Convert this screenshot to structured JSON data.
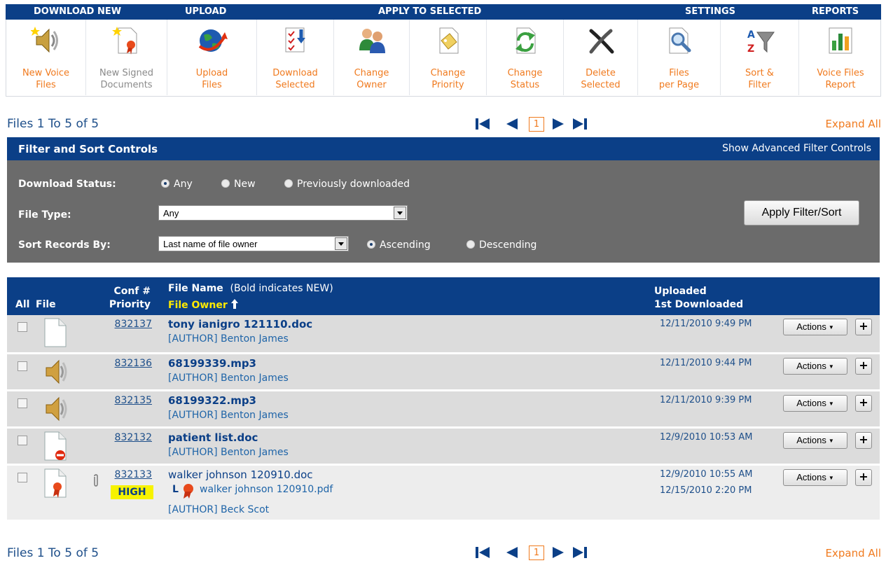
{
  "toolbar": {
    "groups": {
      "download_new": "DOWNLOAD NEW",
      "upload": "UPLOAD",
      "apply_to_selected": "APPLY TO SELECTED",
      "settings": "SETTINGS",
      "reports": "REPORTS"
    },
    "items": [
      {
        "label": "New Voice\nFiles",
        "icon": "speaker-new-icon"
      },
      {
        "label": "New Signed\nDocuments",
        "icon": "signed-document-new-icon"
      },
      {
        "label": "Upload\nFiles",
        "icon": "globe-upload-icon"
      },
      {
        "label": "Download\nSelected",
        "icon": "download-checklist-icon"
      },
      {
        "label": "Change\nOwner",
        "icon": "people-icon"
      },
      {
        "label": "Change\nPriority",
        "icon": "priority-tag-icon"
      },
      {
        "label": "Change\nStatus",
        "icon": "refresh-arrows-icon"
      },
      {
        "label": "Delete\nSelected",
        "icon": "delete-x-icon"
      },
      {
        "label": "Files\nper Page",
        "icon": "magnifier-page-icon"
      },
      {
        "label": "Sort &\nFilter",
        "icon": "sort-filter-icon"
      },
      {
        "label": "Voice Files\nReport",
        "icon": "bar-chart-report-icon"
      }
    ]
  },
  "pager": {
    "files_count": "Files 1 To 5 of 5",
    "page": "1",
    "expand_all": "Expand All"
  },
  "filter": {
    "title": "Filter and Sort Controls",
    "advanced_link": "Show Advanced Filter Controls",
    "download_status_label": "Download Status:",
    "download_status_options": [
      "Any",
      "New",
      "Previously downloaded"
    ],
    "download_status_selected": "Any",
    "file_type_label": "File Type:",
    "file_type_value": "Any",
    "sort_label": "Sort Records By:",
    "sort_value": "Last name of file owner",
    "sort_order_options": [
      "Ascending",
      "Descending"
    ],
    "sort_order_selected": "Ascending",
    "apply_button": "Apply Filter/Sort"
  },
  "table": {
    "col_all": "All",
    "col_file": "File",
    "col_conf": "Conf #",
    "col_priority": "Priority",
    "col_file_name": "File Name",
    "col_file_name_note": "(Bold indicates NEW)",
    "col_file_owner": "File Owner",
    "col_uploaded": "Uploaded",
    "col_first_downloaded": "1st Downloaded",
    "actions_label": "Actions",
    "plus_label": "+",
    "rows": [
      {
        "conf": "832137",
        "file_name": "tony ianigro 121110.doc",
        "owner": "[AUTHOR] Benton James",
        "uploaded": "12/11/2010 9:49 PM",
        "icon": "document-icon"
      },
      {
        "conf": "832136",
        "file_name": "68199339.mp3",
        "owner": "[AUTHOR] Benton James",
        "uploaded": "12/11/2010 9:44 PM",
        "icon": "speaker-icon"
      },
      {
        "conf": "832135",
        "file_name": "68199322.mp3",
        "owner": "[AUTHOR] Benton James",
        "uploaded": "12/11/2010 9:39 PM",
        "icon": "speaker-icon"
      },
      {
        "conf": "832132",
        "file_name": "patient list.doc",
        "owner": "[AUTHOR] Benton James",
        "uploaded": "12/9/2010 10:53 AM",
        "icon": "document-blocked-icon"
      },
      {
        "conf": "832133",
        "priority": "HIGH",
        "file_name": "walker johnson 120910.doc",
        "signed_file": "walker johnson 120910.pdf",
        "owner": "[AUTHOR] Beck Scot",
        "uploaded": "12/9/2010 10:55 AM",
        "first_downloaded": "12/15/2010 2:20 PM",
        "icon": "signed-document-icon",
        "attachment_icon": "paperclip-icon"
      }
    ]
  },
  "colors": {
    "header_blue": "#0b3f87",
    "accent_orange": "#f07a1e",
    "filter_gray": "#6b6b6b",
    "high_yellow": "#f7f300",
    "owner_yellow": "#ffea00"
  }
}
